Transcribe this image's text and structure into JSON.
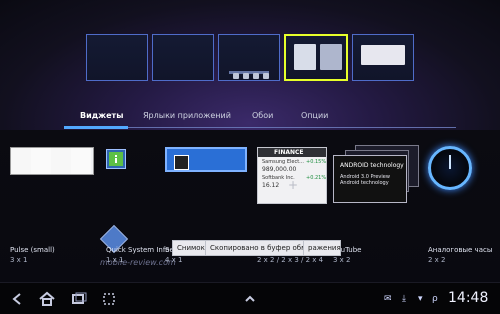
{
  "tabs": [
    {
      "label": "Виджеты",
      "selected": true
    },
    {
      "label": "Ярлыки приложений",
      "selected": false
    },
    {
      "label": "Обои",
      "selected": false
    },
    {
      "label": "Опции",
      "selected": false
    }
  ],
  "widgets": [
    {
      "name": "Pulse (small)",
      "size": "3 x 1"
    },
    {
      "name": "Quick System Info",
      "size": "1 x 1"
    },
    {
      "name": "Se",
      "size": "4 x 1"
    },
    {
      "name": "",
      "size": "2 x 2 / 2 x 3 / 2 x 4"
    },
    {
      "name": "YouTube",
      "size": "3 x 2"
    },
    {
      "name": "Аналоговые часы",
      "size": "2 x 2"
    }
  ],
  "overlay": {
    "toast_left": "Снимок эк",
    "toast_center": "Скопировано в буфер обмена",
    "toast_right": "ражения"
  },
  "watermark": "mobile-review.com",
  "finance": {
    "header": "FINANCE",
    "lines": [
      "Samsung Elect...",
      "989,000.00",
      "+0.15%",
      "Softbank Inc.",
      "16.12",
      "+0.21%"
    ]
  },
  "youtube_preview": {
    "brand": "ANDROID technology",
    "text": "Android 3.0 Preview\nAndroid technology"
  },
  "statusbar": {
    "time": "14:48"
  },
  "colors": {
    "selected_tab": "#52a8ff",
    "screen_border_active": "#e7ff2a",
    "screen_border": "#4f6cc9",
    "clock_glow": "#67b6ff"
  }
}
